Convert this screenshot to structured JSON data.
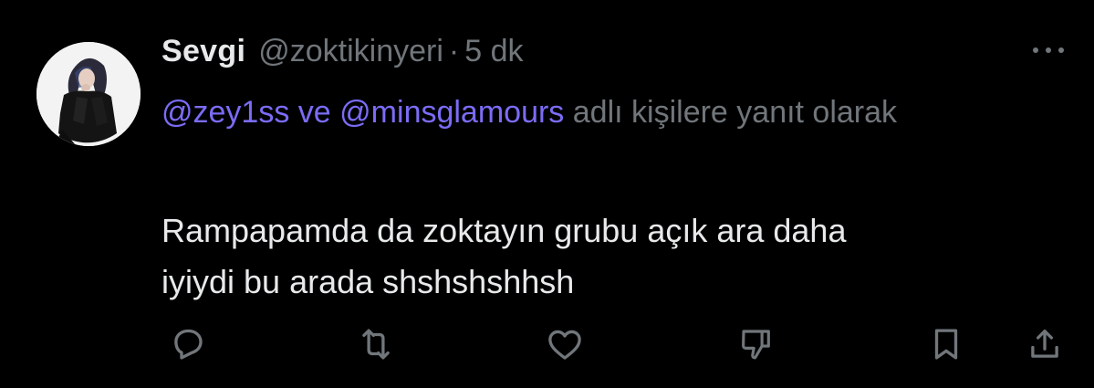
{
  "tweet": {
    "author": {
      "display_name": "Sevgi",
      "handle": "@zoktikinyeri",
      "separator": "·",
      "time": "5 dk"
    },
    "reply_context": {
      "mention_1": "@zey1ss",
      "conjunction": "ve",
      "mention_2": "@minsglamours",
      "suffix": "adlı kişilere yanıt olarak"
    },
    "text_line_1": "Rampapamda da zoktayın grubu açık ara daha",
    "text_line_2": "iyiydi bu arada shshshshhsh",
    "actions": [
      "reply",
      "retweet",
      "like",
      "dislike",
      "bookmark",
      "share"
    ],
    "colors": {
      "background": "#000000",
      "primary_text": "#e7e9ea",
      "secondary_text": "#71767b",
      "mention": "#7b6cf6"
    }
  }
}
